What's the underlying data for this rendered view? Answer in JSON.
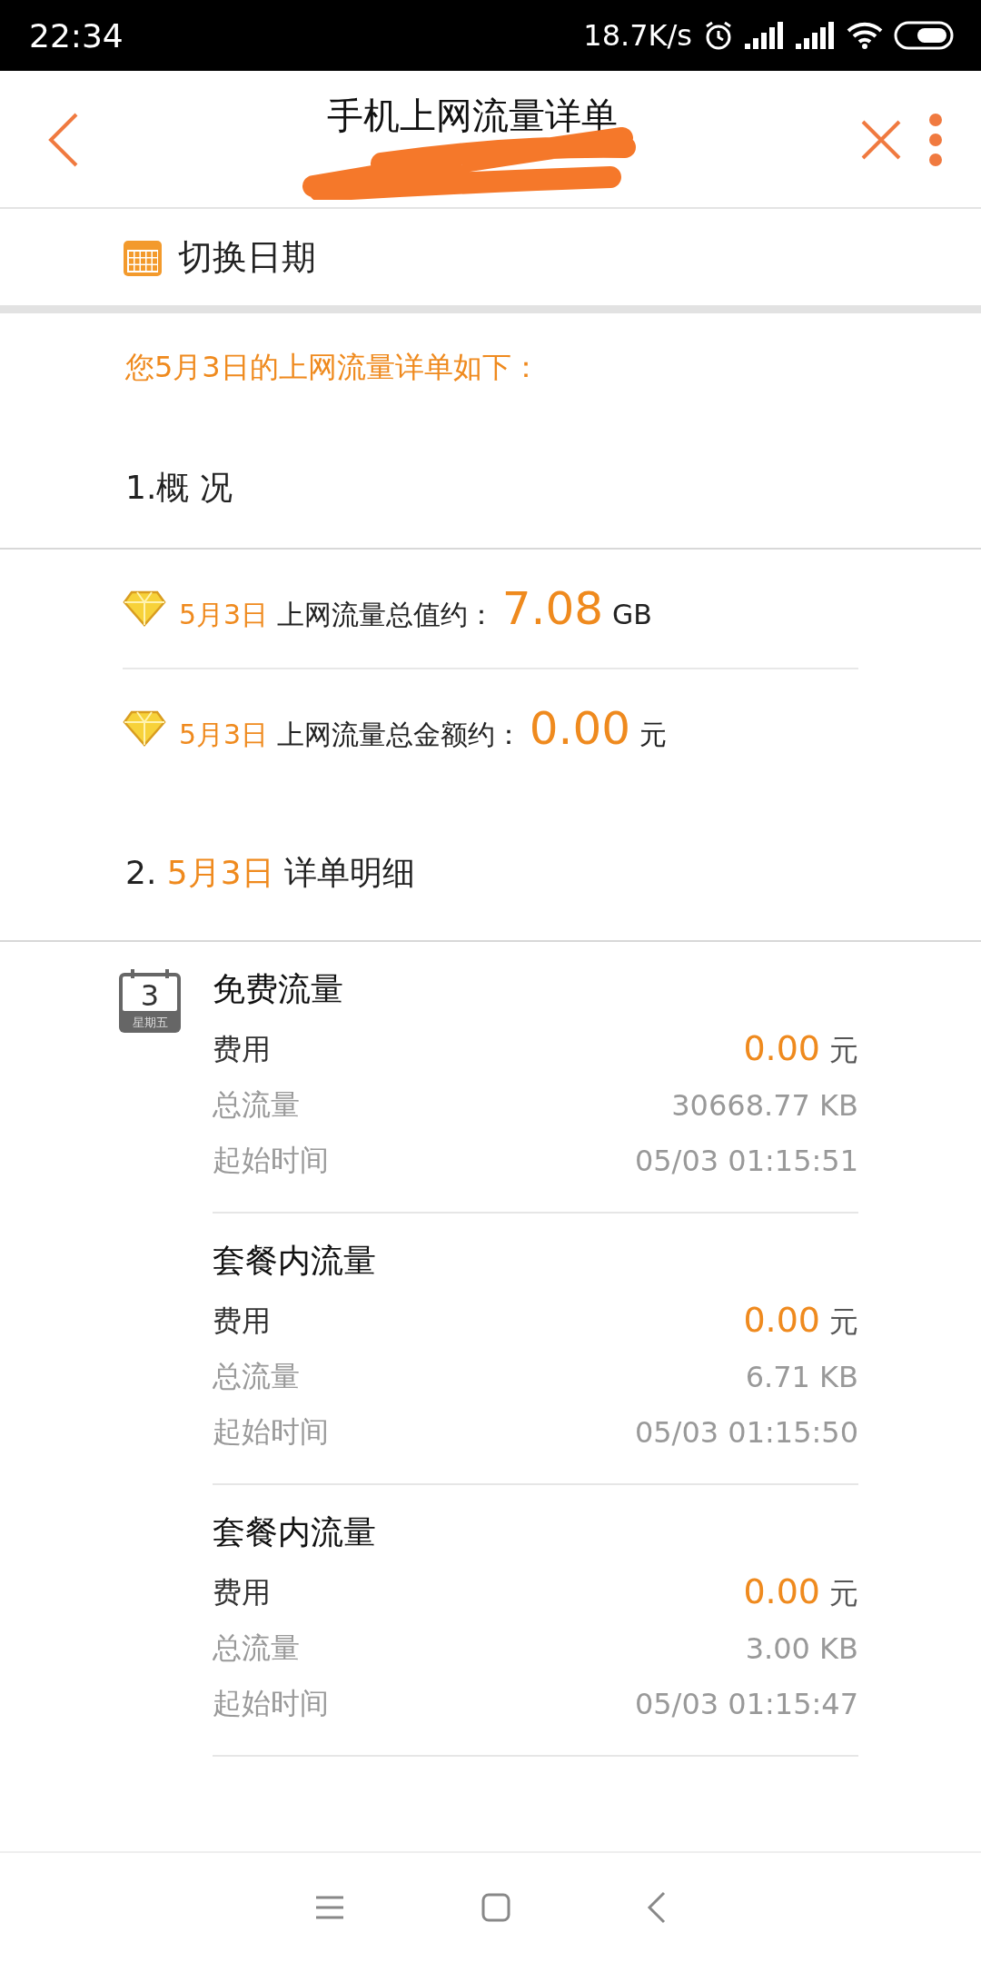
{
  "status_bar": {
    "time": "22:34",
    "speed": "18.7K/s"
  },
  "header": {
    "title": "手机上网流量详单"
  },
  "date_switch": {
    "label": "切换日期"
  },
  "intro": "您5月3日的上网流量详单如下：",
  "overview": {
    "heading": "1.概 况",
    "rows": [
      {
        "date": "5月3日",
        "label": "上网流量总值约：",
        "value": "7.08",
        "unit": "GB"
      },
      {
        "date": "5月3日",
        "label": "上网流量总金额约：",
        "value": "0.00",
        "unit": "元"
      }
    ]
  },
  "details": {
    "prefix": "2.",
    "date": "5月3日",
    "heading": "详单明细",
    "calendar": {
      "day": "3",
      "weekday": "星期五"
    },
    "items": [
      {
        "title": "免费流量",
        "fee_label": "费用",
        "fee": "0.00",
        "fee_unit": "元",
        "total_label": "总流量",
        "total": "30668.77 KB",
        "start_label": "起始时间",
        "start": "05/03 01:15:51"
      },
      {
        "title": "套餐内流量",
        "fee_label": "费用",
        "fee": "0.00",
        "fee_unit": "元",
        "total_label": "总流量",
        "total": "6.71 KB",
        "start_label": "起始时间",
        "start": "05/03 01:15:50"
      },
      {
        "title": "套餐内流量",
        "fee_label": "费用",
        "fee": "0.00",
        "fee_unit": "元",
        "total_label": "总流量",
        "total": "3.00 KB",
        "start_label": "起始时间",
        "start": "05/03 01:15:47"
      }
    ]
  }
}
